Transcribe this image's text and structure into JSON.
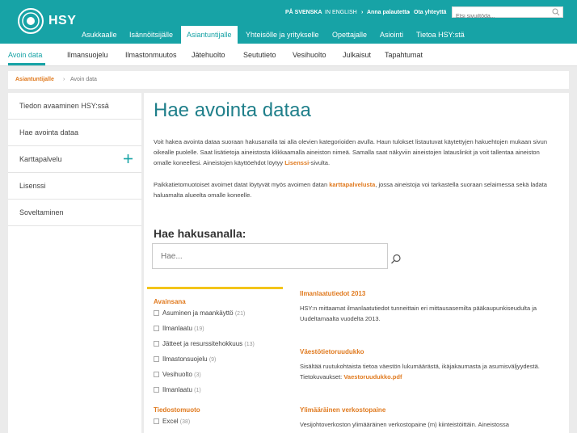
{
  "header": {
    "logo_text": "HSY",
    "utility": {
      "swedish": "PÅ SVENSKA",
      "english": "IN ENGLISH",
      "feedback": "Anna palautetta",
      "contact": "Ota yhteyttä",
      "search_placeholder": "Etsi sivuiltöda..."
    },
    "main_nav": [
      "Asukkaalle",
      "Isännöitsijälle",
      "Asiantuntijalle",
      "Yhteisölle ja yritykselle",
      "Opettajalle",
      "Asiointi",
      "Tietoa HSY:stä"
    ],
    "sub_nav": [
      "Avoin data",
      "Ilmansuojelu",
      "Ilmastonmuutos",
      "Jätehuolto",
      "Seututieto",
      "Vesihuolto",
      "Julkaisut",
      "Tapahtumat"
    ]
  },
  "breadcrumb": {
    "parent": "Asiantuntijalle",
    "separator": "›",
    "current": "Avoin data"
  },
  "sidebar": {
    "items": [
      "Tiedon avaaminen HSY:ssä",
      "Hae avointa dataa",
      "Karttapalvelu",
      "Lisenssi",
      "Soveltaminen"
    ]
  },
  "main": {
    "title": "Hae avointa dataa",
    "intro_1_a": "Voit hakea avointa dataa suoraan hakusanalla tai alla olevien kategorioiden avulla. Haun tulokset listautuvat käytettyjen hakuehtojen mukaan sivun oikealle puolelle. Saat lisätietoja aineistosta klikkaamalla aineiston nimeä. Samalla saat näkyviin aineistojen latauslinkit ja voit tallentaa aineiston omalle koneellesi. Aineistojen käyttöehdot löytyy ",
    "intro_1_link": "Lisenssi",
    "intro_1_b": "-sivulta.",
    "intro_2_a": "Paikkatietomuotoiset avoimet datat löytyvät myös avoimen datan ",
    "intro_2_link": "karttapalvelusta",
    "intro_2_b": ", jossa aineistoja voi tarkastella suoraan selaimessa sekä ladata haluamalta alueelta omalle koneelle.",
    "search_heading": "Hae hakusanalla:",
    "search_placeholder": "Hae..."
  },
  "facets": {
    "group1_title": "Avainsana",
    "group1": [
      {
        "label": "Asuminen ja maankäyttö",
        "count": "(21)"
      },
      {
        "label": "Ilmanlaatu",
        "count": "(19)"
      },
      {
        "label": "Jätteet ja resurssitehokkuus",
        "count": "(13)"
      },
      {
        "label": "Ilmastonsuojelu",
        "count": "(9)"
      },
      {
        "label": "Vesihuolto",
        "count": "(3)"
      },
      {
        "label": "Ilmanlaatu",
        "count": "(1)"
      }
    ],
    "group2_title": "Tiedostomuoto",
    "group2": [
      {
        "label": "Excel",
        "count": "(38)"
      }
    ]
  },
  "results": [
    {
      "title": "Ilmanlaatutiedot 2013",
      "text": "HSY:n mittaamat ilmanlaatutiedot tunneittain eri mittausasemilta pääkaupunkiseudulta ja Uudeltamaalta vuodelta 2013.",
      "link": ""
    },
    {
      "title": "Väestötietoruudukko",
      "text": "Sisältää ruutukohtaista tietoa väestön lukumäärästä, ikäjakaumasta ja asumisväljyydestä. Tietokuvaukset: ",
      "link": "Vaestoruudukko.pdf"
    },
    {
      "title": "Ylimääräinen verkostopaine",
      "text": "Vesijohtoverkoston ylimääräinen verkostopaine (m) kiinteistöittäin. Aineistossa",
      "link": ""
    }
  ],
  "colors": {
    "brand_teal": "#17a3a6",
    "accent_orange": "#e07a1f",
    "facet_yellow": "#f3c41a"
  }
}
